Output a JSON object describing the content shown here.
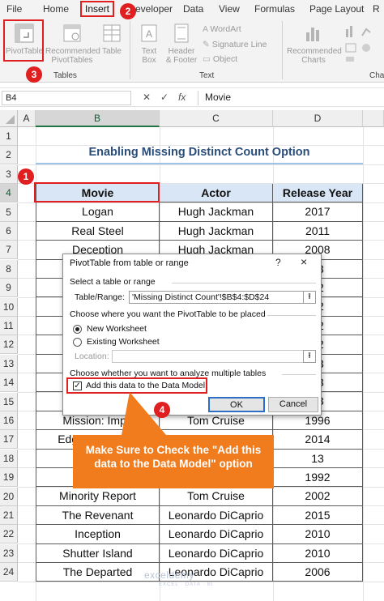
{
  "menu": {
    "items": [
      "File",
      "Home",
      "Insert",
      "eveloper",
      "Data",
      "View",
      "Formulas",
      "Page Layout"
    ]
  },
  "ribbon": {
    "pivottable": "PivotTable",
    "recommended_pivottables": [
      "Recommended",
      "PivotTables"
    ],
    "table": "Table",
    "text_box": [
      "Text",
      "Box"
    ],
    "header_footer": [
      "Header",
      "& Footer"
    ],
    "wordart": "WordArt",
    "signature_line": "Signature Line",
    "object": "Object",
    "recommended_charts": [
      "Recommended",
      "Charts"
    ],
    "group_tables": "Tables",
    "group_text": "Text",
    "group_charts_partial": "Cha",
    "edge_partial": "R"
  },
  "badges": {
    "insert": "2",
    "pivot": "3",
    "movie": "1",
    "checkbox": "4"
  },
  "formula_bar": {
    "cell_ref": "B4",
    "fx": "fx",
    "content": "Movie"
  },
  "grid": {
    "columns": [
      "A",
      "B",
      "C",
      "D"
    ],
    "rows": [
      "1",
      "2",
      "3",
      "4",
      "5",
      "6",
      "7",
      "8",
      "9",
      "10",
      "11",
      "12",
      "13",
      "14",
      "15",
      "16",
      "17",
      "18",
      "19",
      "20",
      "21",
      "22",
      "23",
      "24"
    ]
  },
  "sheet": {
    "title": "Enabling Missing Distinct Count Option",
    "headers": [
      "Movie",
      "Actor",
      "Release Year"
    ],
    "rows": [
      [
        "Logan",
        "Hugh Jackman",
        "2017"
      ],
      [
        "Real Steel",
        "Hugh Jackman",
        "2011"
      ],
      [
        "Deception",
        "Hugh Jackman",
        "2008"
      ],
      [
        "",
        "",
        "13"
      ],
      [
        "",
        "",
        "12"
      ],
      [
        "",
        "",
        "12"
      ],
      [
        "",
        "",
        "12"
      ],
      [
        "",
        "",
        "12"
      ],
      [
        "",
        "",
        "13"
      ],
      [
        "",
        "",
        "13"
      ],
      [
        "",
        "",
        "13"
      ],
      [
        "Mission: Impo",
        "Tom Cruise",
        "1996"
      ],
      [
        "Edge Of Tomorr",
        "Tom Cruise",
        "2014"
      ],
      [
        "J",
        "",
        "13"
      ],
      [
        "A F",
        "",
        "1992"
      ],
      [
        "Minority Report",
        "Tom Cruise",
        "2002"
      ],
      [
        "The Revenant",
        "Leonardo DiCaprio",
        "2015"
      ],
      [
        "Inception",
        "Leonardo DiCaprio",
        "2010"
      ],
      [
        "Shutter Island",
        "Leonardo DiCaprio",
        "2010"
      ],
      [
        "The Departed",
        "Leonardo DiCaprio",
        "2006"
      ]
    ]
  },
  "dialog": {
    "title": "PivotTable from table or range",
    "help": "?",
    "close": "×",
    "section_select": "Select a table or range",
    "table_range_label": "Table/Range:",
    "table_range_value": "'Missing Distinct Count'!$B$4:$D$24",
    "section_place": "Choose where you want the PivotTable to be placed",
    "option_new": "New Worksheet",
    "option_existing": "Existing Worksheet",
    "location_label": "Location:",
    "location_value": "",
    "section_multi": "Choose whether you want to analyze multiple tables",
    "datamodel_label": "Add this data to the Data Model",
    "datamodel_checked": true,
    "ok": "OK",
    "cancel": "Cancel"
  },
  "callout": {
    "text": "Make Sure to Check the \"Add this data to the Data Model\" option"
  },
  "watermark": {
    "name": "exceldemy",
    "tagline": "EXCEL · DATA · BI"
  },
  "colors": {
    "highlight_red": "#e02020",
    "callout_orange": "#f07c1e",
    "header_fill": "#d9e6f5",
    "title_color": "#2a4d7a",
    "excel_green": "#217346"
  }
}
